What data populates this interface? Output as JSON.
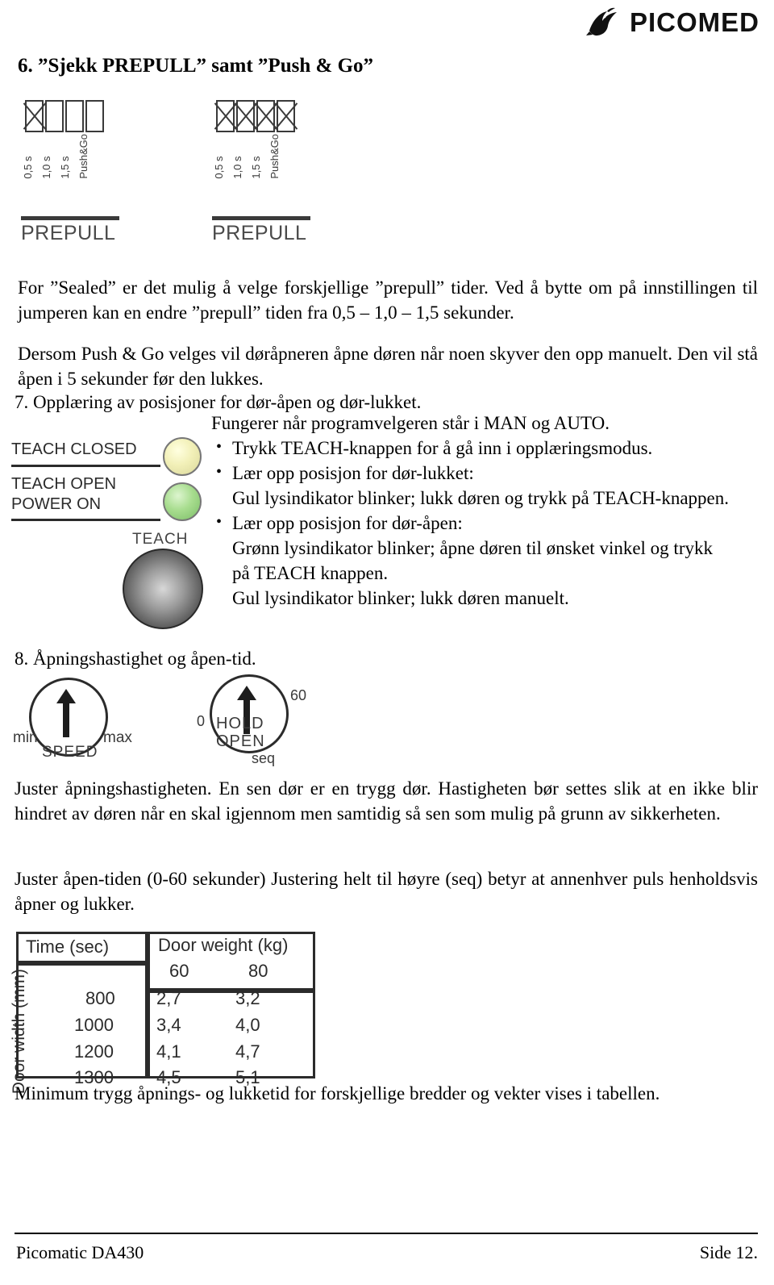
{
  "header": {
    "brand": "PICOMED",
    "logo_icon": "bird-logo-icon"
  },
  "section6": {
    "title": "6. ”Sjekk PREPULL” samt ”Push & Go”",
    "diagram": {
      "dip_labels": [
        "0,5 s",
        "1,0 s",
        "1,5 s",
        "Push&Go"
      ],
      "unit_a_name": "PREPULL",
      "unit_b_name": "PREPULL",
      "unit_a_switches": [
        "x",
        "off",
        "off",
        "off"
      ],
      "unit_b_switches": [
        "x",
        "x",
        "x",
        "x"
      ]
    },
    "paragraph_sealed": "For ”Sealed” er det mulig å velge forskjellige ”prepull” tider. Ved å bytte om på innstillingen til jumperen kan en endre ”prepull” tiden fra 0,5 – 1,0 – 1,5 sekunder.",
    "paragraph_push": "Dersom Push & Go velges vil døråpneren åpne døren når noen skyver den opp manuelt. Den vil stå åpen i 5 sekunder før den lukkes."
  },
  "section7": {
    "heading": "7. Opplæring av posisjoner for dør-åpen og dør-lukket.",
    "intro": "Fungerer når programvelgeren står i MAN og AUTO.",
    "bullets": [
      {
        "lines": [
          "Trykk TEACH-knappen for å gå inn i opplæringsmodus."
        ]
      },
      {
        "lines": [
          "Lær opp posisjon for dør-lukket:",
          "Gul lysindikator blinker; lukk døren og trykk på TEACH-knappen."
        ]
      },
      {
        "lines": [
          "Lær opp posisjon for dør-åpen:",
          "Grønn lysindikator blinker; åpne døren til ønsket vinkel og trykk",
          "på TEACH knappen.",
          "Gul lysindikator blinker; lukk døren manuelt."
        ]
      }
    ],
    "panel": {
      "label_teach_closed": "TEACH CLOSED",
      "label_teach_open": "TEACH OPEN",
      "label_power_on": "POWER ON",
      "label_teach_button": "TEACH",
      "led_yellow_color": "#f2f0b8",
      "led_green_color": "#a8dd8f"
    }
  },
  "section8": {
    "heading": "8. Åpningshastighet og åpen-tid.",
    "knob_speed": {
      "min_label": "min",
      "max_label": "max",
      "name_label": "SPEED"
    },
    "knob_hold": {
      "zero_label": "0",
      "sixty_label": "60",
      "name_label": "HOLD",
      "open_label": "OPEN",
      "seq_label": "seq"
    },
    "paragraph_speed": "Juster åpningshastigheten. En sen dør er en trygg dør. Hastigheten bør settes slik at en ikke blir hindret av døren når en skal igjennom men samtidig så sen som mulig på grunn av sikkerheten.",
    "paragraph_hold": "Juster åpen-tiden (0-60 sekunder) Justering helt til høyre (seq) betyr at annenhver puls henholdsvis åpner og lukker."
  },
  "table": {
    "corner_label_time": "Time (sec)",
    "header_group": "Door weight (kg)",
    "weight_columns": [
      "60",
      "80"
    ],
    "row_label": "Door width (mm)",
    "rows": [
      {
        "width": "800",
        "w60": "2,7",
        "w80": "3,2"
      },
      {
        "width": "1000",
        "w60": "3,4",
        "w80": "4,0"
      },
      {
        "width": "1200",
        "w60": "4,1",
        "w80": "4,7"
      },
      {
        "width": "1300",
        "w60": "4,5",
        "w80": "5,1"
      }
    ],
    "caption": "Minimum trygg åpnings- og lukketid for forskjellige bredder og vekter vises i tabellen."
  },
  "footer": {
    "left": "Picomatic DA430",
    "right": "Side 12."
  }
}
